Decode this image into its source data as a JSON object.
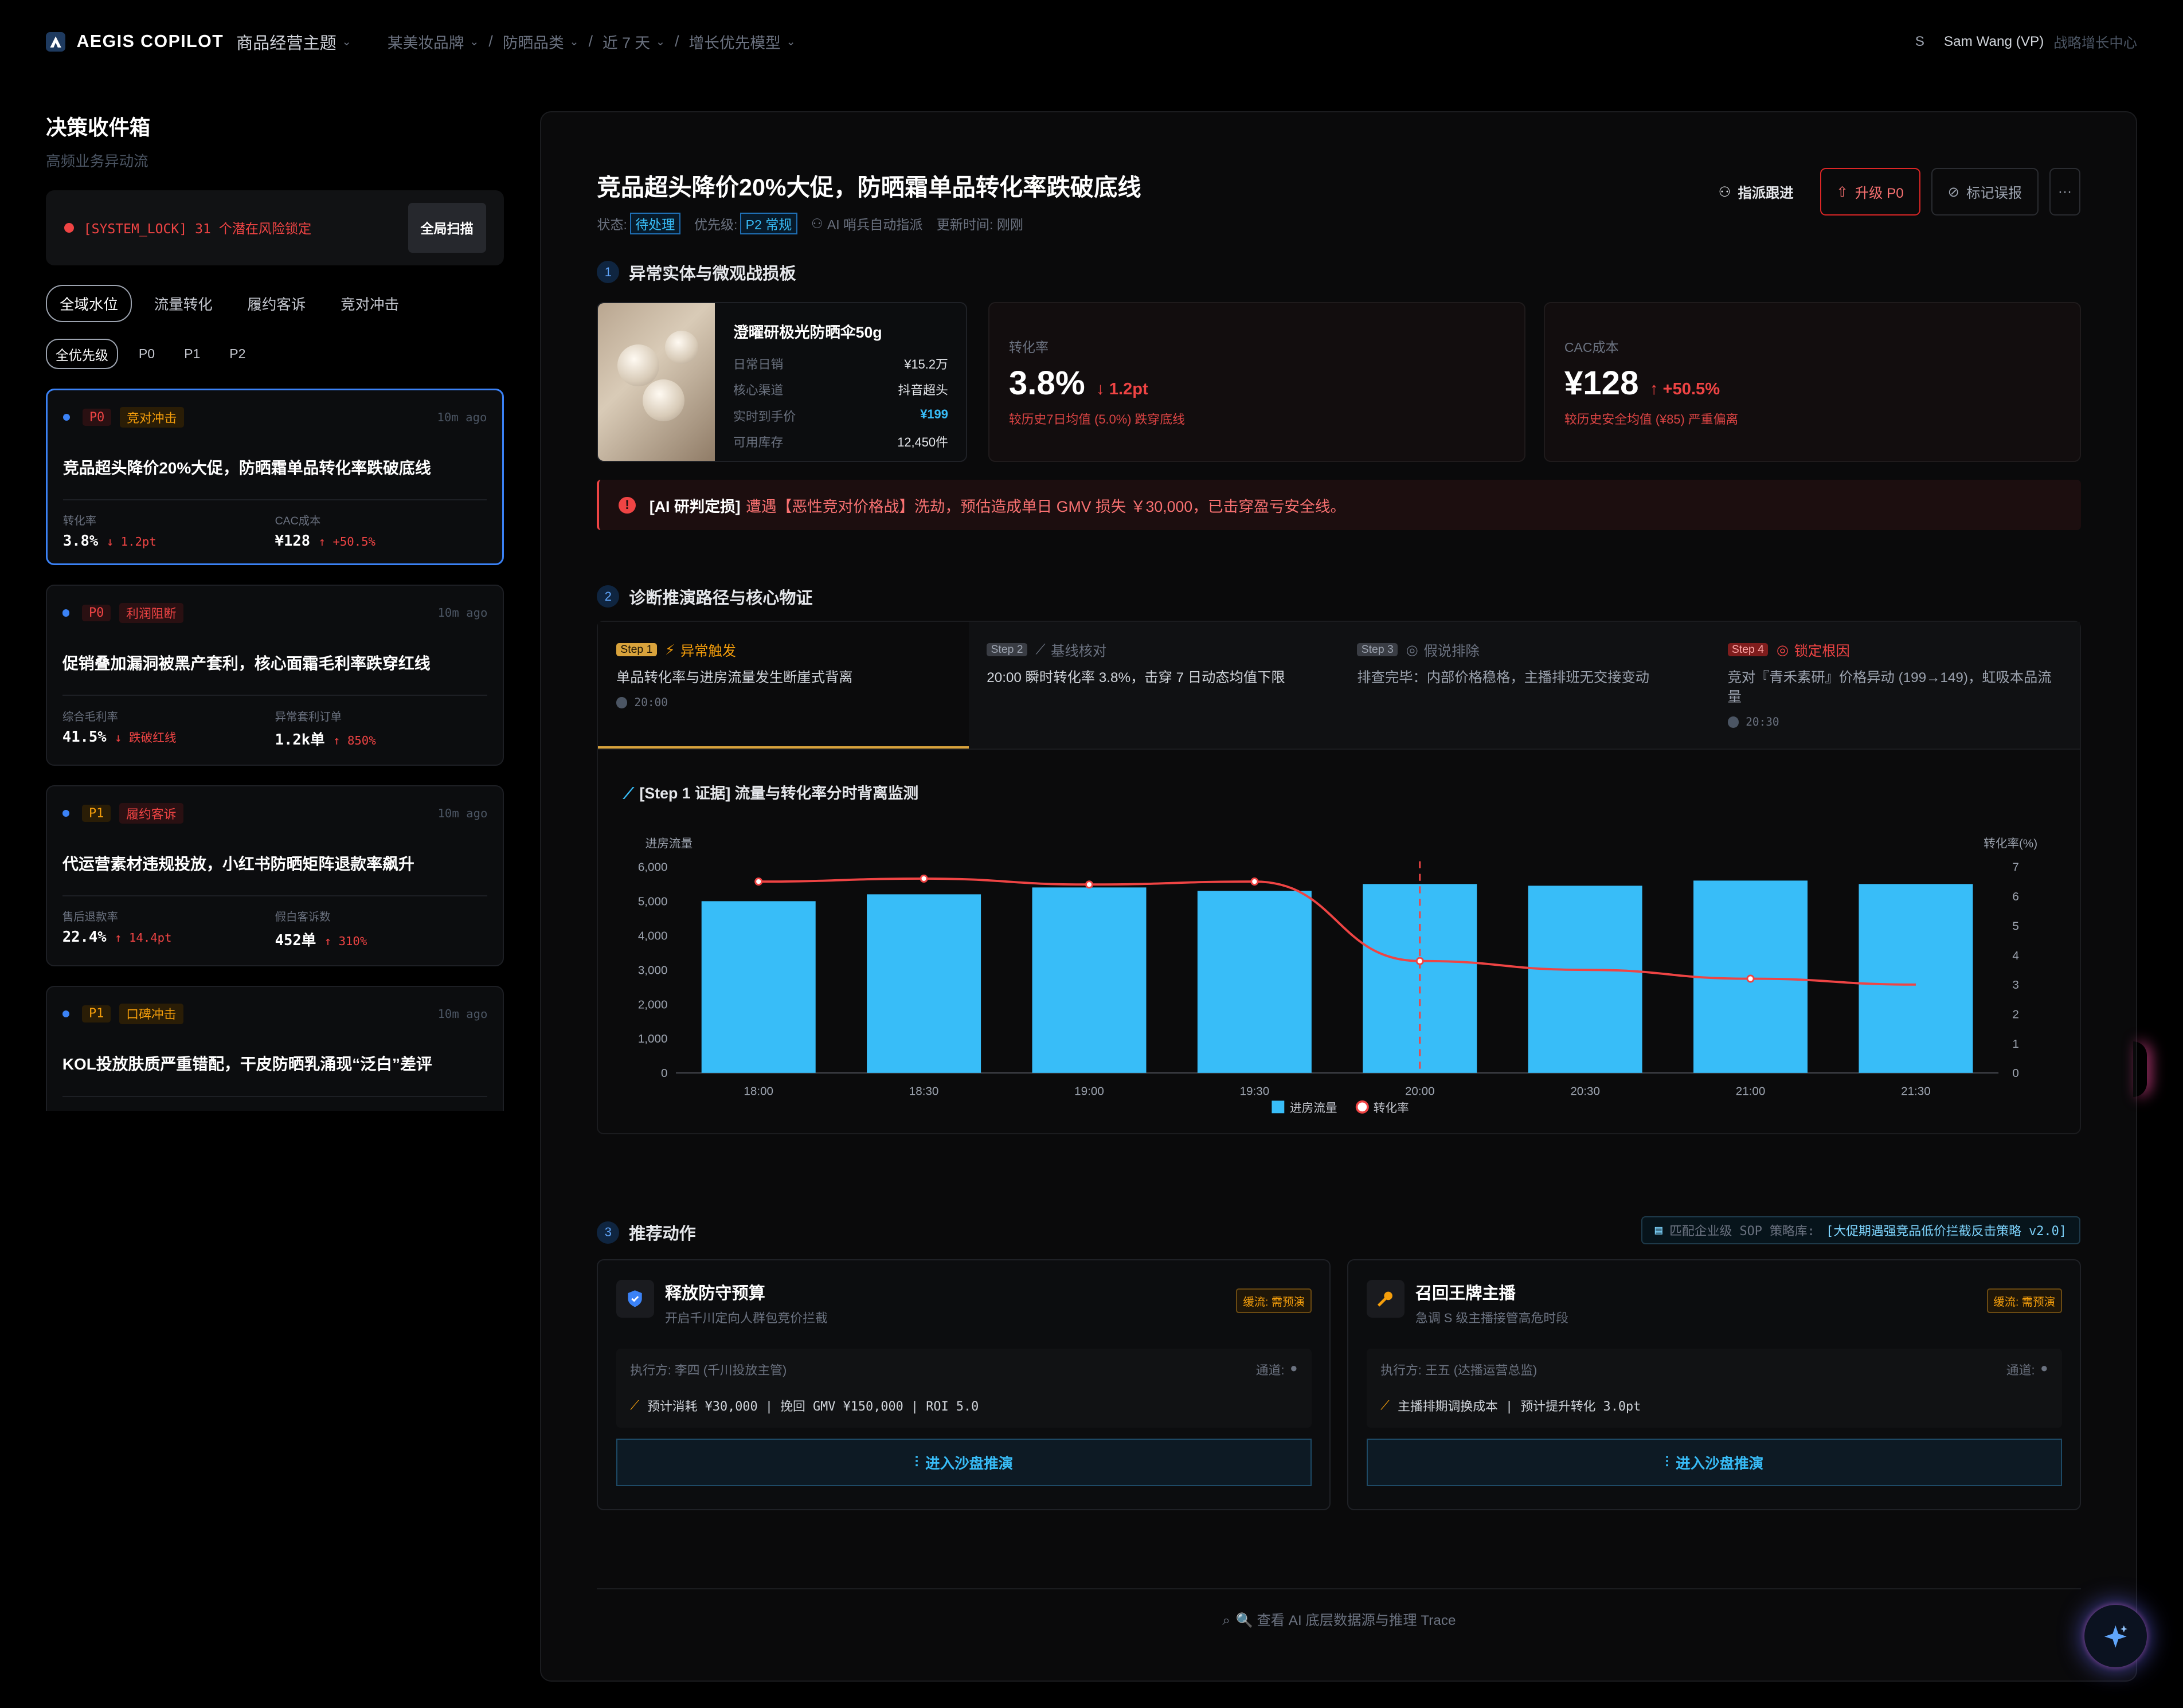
{
  "topbar": {
    "brand": "AEGIS COPILOT",
    "theme": "商品经营主题",
    "crumbs": [
      "某美妆品牌",
      "防晒品类",
      "近 7 天",
      "增长优先模型"
    ],
    "user_initial": "S",
    "user_name": "Sam Wang (VP)",
    "user_org": "战略增长中心"
  },
  "sidebar": {
    "title": "决策收件箱",
    "subtitle": "高频业务异动流",
    "lock_text": "[SYSTEM_LOCK] 31 个潜在风险锁定",
    "scan_label": "全局扫描",
    "tabs": [
      "全域水位",
      "流量转化",
      "履约客诉",
      "竞对冲击"
    ],
    "priority_tabs": [
      "全优先级",
      "P0",
      "P1",
      "P2"
    ],
    "cards": [
      {
        "priority": "P0",
        "tag": "竞对冲击",
        "ago": "10m ago",
        "title": "竞品超头降价20%大促，防晒霜单品转化率跌破底线",
        "m1_label": "转化率",
        "m1_value": "3.8%",
        "m1_delta": "↓ 1.2pt",
        "m2_label": "CAC成本",
        "m2_value": "¥128",
        "m2_delta": "↑ +50.5%"
      },
      {
        "priority": "P0",
        "tag": "利润阻断",
        "ago": "10m ago",
        "title": "促销叠加漏洞被黑产套利，核心面霜毛利率跌穿红线",
        "m1_label": "综合毛利率",
        "m1_value": "41.5%",
        "m1_delta": "↓ 跌破红线",
        "m2_label": "异常套利订单",
        "m2_value": "1.2k单",
        "m2_delta": "↑ 850%"
      },
      {
        "priority": "P1",
        "tag": "履约客诉",
        "ago": "10m ago",
        "title": "代运营素材违规投放，小红书防晒矩阵退款率飙升",
        "m1_label": "售后退款率",
        "m1_value": "22.4%",
        "m1_delta": "↑ 14.4pt",
        "m2_label": "假白客诉数",
        "m2_value": "452单",
        "m2_delta": "↑ 310%"
      },
      {
        "priority": "P1",
        "tag": "口碑冲击",
        "ago": "10m ago",
        "title": "KOL投放肤质严重错配，干皮防晒乳涌现“泛白”差评"
      }
    ]
  },
  "main": {
    "title": "竞品超头降价20%大促，防晒霜单品转化率跌破底线",
    "meta": {
      "status_label": "状态:",
      "status": "待处理",
      "priority_label": "优先级:",
      "priority": "P2 常规",
      "assignee": "AI 哨兵自动指派",
      "updated": "更新时间: 刚刚"
    },
    "actions": {
      "assign": "指派跟进",
      "upgrade": "升级 P0",
      "mark": "标记误报",
      "more": "···"
    },
    "section1": {
      "num": "1",
      "title": "异常实体与微观战损板"
    },
    "product": {
      "name": "澄曜研极光防晒伞50g",
      "rows": [
        {
          "label": "日常日销",
          "value": "¥15.2万"
        },
        {
          "label": "核心渠道",
          "value": "抖音超头"
        },
        {
          "label": "实时到手价",
          "value": "¥199"
        },
        {
          "label": "可用库存",
          "value": "12,450件"
        }
      ]
    },
    "kpis": [
      {
        "label": "转化率",
        "value": "3.8%",
        "delta": "↓ 1.2pt",
        "note": "较历史7日均值 (5.0%) 跌穿底线"
      },
      {
        "label": "CAC成本",
        "value": "¥128",
        "delta": "↑ +50.5%",
        "note": "较历史安全均值 (¥85) 严重偏离"
      }
    ],
    "alert": {
      "label": "[AI 研判定损]",
      "text": "遭遇【恶性竞对价格战】洗劫，预估造成单日 GMV 损失 ￥30,000，已击穿盈亏安全线。"
    },
    "section2": {
      "num": "2",
      "title": "诊断推演路径与核心物证"
    },
    "steps": [
      {
        "badge": "Step 1",
        "label": "异常触发",
        "desc": "单品转化率与进房流量发生断崖式背离",
        "time": "20:00"
      },
      {
        "badge": "Step 2",
        "label": "基线核对",
        "desc": "20:00 瞬时转化率 3.8%，击穿 7 日动态均值下限",
        "time": ""
      },
      {
        "badge": "Step 3",
        "label": "假说排除",
        "desc": "排查完毕：内部价格稳格，主播排班无交接变动",
        "time": ""
      },
      {
        "badge": "Step 4",
        "label": "锁定根因",
        "desc": "竞对『青禾素研』价格异动 (199→149)，虹吸本品流量",
        "time": "20:30"
      }
    ],
    "chart_title": "[Step 1 证据] 流量与转化率分时背离监测",
    "section3": {
      "num": "3",
      "title": "推荐动作"
    },
    "sop": {
      "label": "匹配企业级 SOP 策略库:",
      "value": "[大促期遇强竞品低价拦截反击策略 v2.0]"
    },
    "recs": [
      {
        "name": "释放防守预算",
        "sub": "开启千川定向人群包竞价拦截",
        "tag": "缓流: 需预演",
        "executor": "执行方: 李四 (千川投放主管)",
        "channel": "通道:",
        "calc": "预计消耗 ¥30,000 | 挽回 GMV ¥150,000 | ROI 5.0",
        "button": "进入沙盘推演"
      },
      {
        "name": "召回王牌主播",
        "sub": "急调 S 级主播接管高危时段",
        "tag": "缓流: 需预演",
        "executor": "执行方: 王五 (达播运营总监)",
        "channel": "通道:",
        "calc": "主播排期调换成本 | 预计提升转化 3.0pt",
        "button": "进入沙盘推演"
      }
    ],
    "trace": "🔍 查看 AI 底层数据源与推理 Trace"
  },
  "chart_data": {
    "type": "bar",
    "categories": [
      "18:00",
      "18:30",
      "19:00",
      "19:30",
      "20:00",
      "20:30",
      "21:00",
      "21:30"
    ],
    "series": [
      {
        "name": "进房流量",
        "type": "bar",
        "axis": "left",
        "values": [
          5000,
          5200,
          5400,
          5300,
          5500,
          5450,
          5600,
          5500
        ]
      },
      {
        "name": "转化率",
        "type": "line",
        "axis": "right",
        "values": [
          6.5,
          6.6,
          6.4,
          6.5,
          3.8,
          3.5,
          3.2,
          3.0
        ]
      }
    ],
    "ylabel_left": "进房流量",
    "ylabel_right": "转化率(%)",
    "ylim_left": [
      0,
      6000
    ],
    "yticks_left": [
      "0",
      "1,000",
      "2,000",
      "3,000",
      "4,000",
      "5,000",
      "6,000"
    ],
    "ylim_right": [
      0,
      7
    ],
    "yticks_right": [
      "0",
      "1",
      "2",
      "3",
      "4",
      "5",
      "6",
      "7"
    ],
    "marker_x": "20:00",
    "legend": "bottom",
    "colors": {
      "bar": "#38bdf8",
      "line": "#ef4444"
    }
  }
}
